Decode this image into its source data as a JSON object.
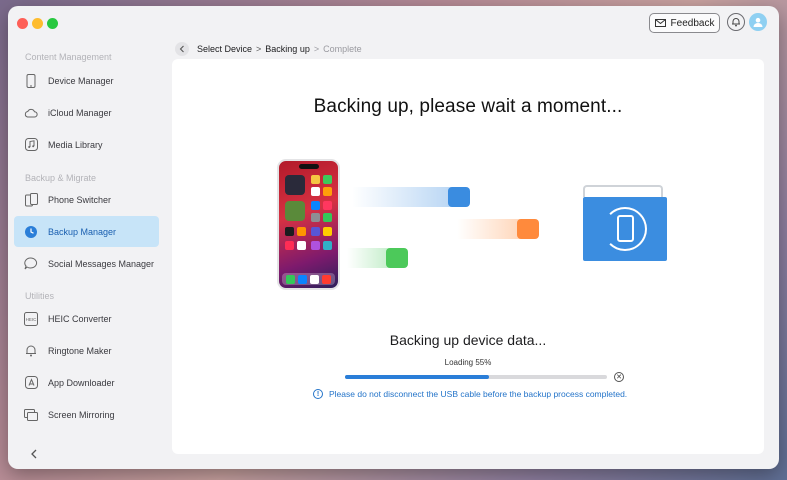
{
  "colors": {
    "accent": "#2a7ed8",
    "active_bg": "#c7e4f8",
    "folder": "#3b8de0"
  },
  "header": {
    "feedback_label": "Feedback",
    "feedback_icon": "mail-icon",
    "bell_icon": "bell-icon",
    "avatar_icon": "user-avatar-icon"
  },
  "sidebar": {
    "sections": [
      {
        "label": "Content Management",
        "items": [
          {
            "label": "Device Manager",
            "icon": "phone-icon"
          },
          {
            "label": "iCloud Manager",
            "icon": "cloud-icon"
          },
          {
            "label": "Media Library",
            "icon": "music-icon"
          }
        ]
      },
      {
        "label": "Backup & Migrate",
        "items": [
          {
            "label": "Phone Switcher",
            "icon": "phone-switch-icon"
          },
          {
            "label": "Backup Manager",
            "icon": "backup-clock-icon",
            "active": true
          },
          {
            "label": "Social Messages Manager",
            "icon": "chat-icon"
          }
        ]
      },
      {
        "label": "Utilities",
        "items": [
          {
            "label": "HEIC Converter",
            "icon": "heic-icon"
          },
          {
            "label": "Ringtone Maker",
            "icon": "bell-icon"
          },
          {
            "label": "App Downloader",
            "icon": "app-store-icon"
          },
          {
            "label": "Screen Mirroring",
            "icon": "mirror-icon"
          }
        ]
      }
    ],
    "collapse_icon": "chevron-left-icon"
  },
  "breadcrumb": {
    "step1": "Select Device",
    "step2": "Backing up",
    "step3": "Complete",
    "sep": ">"
  },
  "main": {
    "headline": "Backing up, please wait a moment...",
    "status": "Backing up device data...",
    "loading_label": "Loading 55%",
    "progress": 0.55,
    "warning": "Please do not disconnect the USB cable before the backup process completed."
  }
}
